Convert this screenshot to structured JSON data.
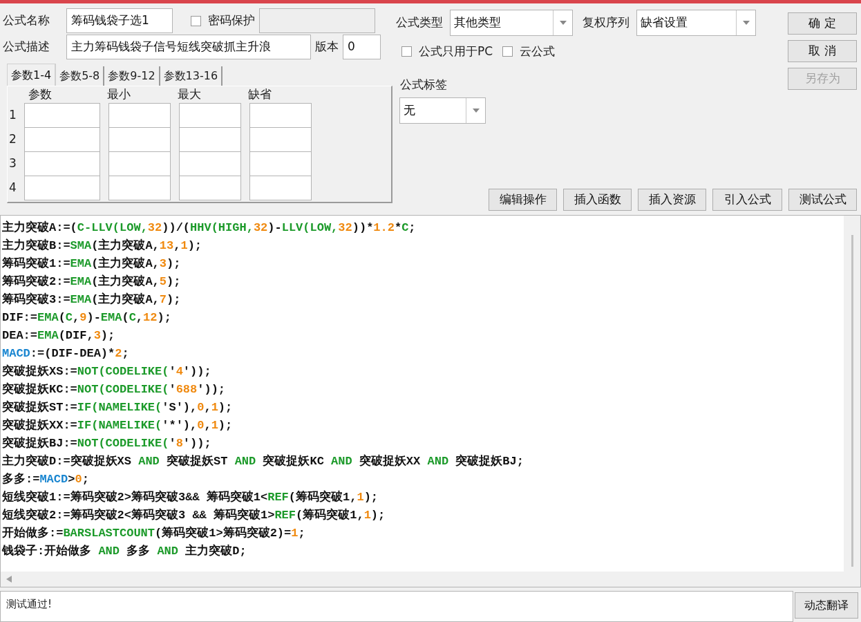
{
  "form": {
    "name": {
      "label": "公式名称",
      "value": "筹码钱袋子选1"
    },
    "password": {
      "label": "密码保护",
      "checked": false
    },
    "password_field": {
      "disabled": true
    },
    "description": {
      "label": "公式描述",
      "value": "主力筹码钱袋子信号短线突破抓主升浪"
    },
    "version": {
      "label": "版本",
      "value": "0"
    }
  },
  "tabs": [
    {
      "label": "参数1-4",
      "selected": true
    },
    {
      "label": "参数5-8",
      "selected": false
    },
    {
      "label": "参数9-12",
      "selected": false
    },
    {
      "label": "参数13-16",
      "selected": false
    }
  ],
  "params": {
    "columns": [
      "参数",
      "最小",
      "最大",
      "缺省"
    ],
    "rows": [
      "1",
      "2",
      "3",
      "4"
    ]
  },
  "formula_type": {
    "label": "公式类型",
    "value": "其他类型"
  },
  "adjust": {
    "label": "复权序列",
    "value": "缺省设置"
  },
  "options": [
    {
      "label": "公式只用于PC",
      "checked": false
    },
    {
      "label": "云公式",
      "checked": false
    }
  ],
  "tag": {
    "label": "公式标签",
    "value": "无"
  },
  "side_buttons": [
    {
      "label": "确 定",
      "disabled": false
    },
    {
      "label": "取 消",
      "disabled": false
    },
    {
      "label": "另存为",
      "disabled": true
    }
  ],
  "tool_buttons": [
    "编辑操作",
    "插入函数",
    "插入资源",
    "引入公式",
    "测试公式"
  ],
  "code": [
    [
      {
        "kind": "text",
        "text": "主力突破A:=("
      },
      {
        "kind": "func",
        "text": "C-LLV(LOW,"
      },
      {
        "kind": "num",
        "text": "32"
      },
      {
        "kind": "text",
        "text": "))/("
      },
      {
        "kind": "func",
        "text": "HHV(HIGH,"
      },
      {
        "kind": "num",
        "text": "32"
      },
      {
        "kind": "text",
        "text": ")-"
      },
      {
        "kind": "func",
        "text": "LLV(LOW,"
      },
      {
        "kind": "num",
        "text": "32"
      },
      {
        "kind": "text",
        "text": "))*"
      },
      {
        "kind": "num",
        "text": "1.2"
      },
      {
        "kind": "text",
        "text": "*"
      },
      {
        "kind": "func",
        "text": "C"
      },
      {
        "kind": "text",
        "text": ";"
      }
    ],
    [
      {
        "kind": "text",
        "text": "主力突破B:="
      },
      {
        "kind": "func",
        "text": "SMA"
      },
      {
        "kind": "text",
        "text": "(主力突破A,"
      },
      {
        "kind": "num",
        "text": "13"
      },
      {
        "kind": "text",
        "text": ","
      },
      {
        "kind": "num",
        "text": "1"
      },
      {
        "kind": "text",
        "text": ");"
      }
    ],
    [
      {
        "kind": "text",
        "text": "筹码突破1:="
      },
      {
        "kind": "func",
        "text": "EMA"
      },
      {
        "kind": "text",
        "text": "(主力突破A,"
      },
      {
        "kind": "num",
        "text": "3"
      },
      {
        "kind": "text",
        "text": ");"
      }
    ],
    [
      {
        "kind": "text",
        "text": "筹码突破2:="
      },
      {
        "kind": "func",
        "text": "EMA"
      },
      {
        "kind": "text",
        "text": "(主力突破A,"
      },
      {
        "kind": "num",
        "text": "5"
      },
      {
        "kind": "text",
        "text": ");"
      }
    ],
    [
      {
        "kind": "text",
        "text": "筹码突破3:="
      },
      {
        "kind": "func",
        "text": "EMA"
      },
      {
        "kind": "text",
        "text": "(主力突破A,"
      },
      {
        "kind": "num",
        "text": "7"
      },
      {
        "kind": "text",
        "text": ");"
      }
    ],
    [
      {
        "kind": "text",
        "text": "DIF:="
      },
      {
        "kind": "func",
        "text": "EMA"
      },
      {
        "kind": "text",
        "text": "("
      },
      {
        "kind": "func",
        "text": "C"
      },
      {
        "kind": "text",
        "text": ","
      },
      {
        "kind": "num",
        "text": "9"
      },
      {
        "kind": "text",
        "text": ")-"
      },
      {
        "kind": "func",
        "text": "EMA"
      },
      {
        "kind": "text",
        "text": "("
      },
      {
        "kind": "func",
        "text": "C"
      },
      {
        "kind": "text",
        "text": ","
      },
      {
        "kind": "num",
        "text": "12"
      },
      {
        "kind": "text",
        "text": ");"
      }
    ],
    [
      {
        "kind": "text",
        "text": "DEA:="
      },
      {
        "kind": "func",
        "text": "EMA"
      },
      {
        "kind": "text",
        "text": "(DIF,"
      },
      {
        "kind": "num",
        "text": "3"
      },
      {
        "kind": "text",
        "text": ");"
      }
    ],
    [
      {
        "kind": "var",
        "text": "MACD"
      },
      {
        "kind": "text",
        "text": ":=(DIF-DEA)*"
      },
      {
        "kind": "num",
        "text": "2"
      },
      {
        "kind": "text",
        "text": ";"
      }
    ],
    [
      {
        "kind": "text",
        "text": "突破捉妖XS:="
      },
      {
        "kind": "func",
        "text": "NOT(CODELIKE("
      },
      {
        "kind": "text",
        "text": "'"
      },
      {
        "kind": "num",
        "text": "4"
      },
      {
        "kind": "text",
        "text": "'));"
      }
    ],
    [
      {
        "kind": "text",
        "text": "突破捉妖KC:="
      },
      {
        "kind": "func",
        "text": "NOT(CODELIKE("
      },
      {
        "kind": "text",
        "text": "'"
      },
      {
        "kind": "num",
        "text": "688"
      },
      {
        "kind": "text",
        "text": "'));"
      }
    ],
    [
      {
        "kind": "text",
        "text": "突破捉妖ST:="
      },
      {
        "kind": "func",
        "text": "IF(NAMELIKE("
      },
      {
        "kind": "text",
        "text": "'S'),"
      },
      {
        "kind": "num",
        "text": "0"
      },
      {
        "kind": "text",
        "text": ","
      },
      {
        "kind": "num",
        "text": "1"
      },
      {
        "kind": "text",
        "text": ");"
      }
    ],
    [
      {
        "kind": "text",
        "text": "突破捉妖XX:="
      },
      {
        "kind": "func",
        "text": "IF(NAMELIKE("
      },
      {
        "kind": "text",
        "text": "'*'),"
      },
      {
        "kind": "num",
        "text": "0"
      },
      {
        "kind": "text",
        "text": ","
      },
      {
        "kind": "num",
        "text": "1"
      },
      {
        "kind": "text",
        "text": ");"
      }
    ],
    [
      {
        "kind": "text",
        "text": "突破捉妖BJ:="
      },
      {
        "kind": "func",
        "text": "NOT(CODELIKE("
      },
      {
        "kind": "text",
        "text": "'"
      },
      {
        "kind": "num",
        "text": "8"
      },
      {
        "kind": "text",
        "text": "'));"
      }
    ],
    [
      {
        "kind": "text",
        "text": "主力突破D:=突破捉妖XS "
      },
      {
        "kind": "func",
        "text": "AND"
      },
      {
        "kind": "text",
        "text": " 突破捉妖ST "
      },
      {
        "kind": "func",
        "text": "AND"
      },
      {
        "kind": "text",
        "text": " 突破捉妖KC "
      },
      {
        "kind": "func",
        "text": "AND"
      },
      {
        "kind": "text",
        "text": " 突破捉妖XX "
      },
      {
        "kind": "func",
        "text": "AND"
      },
      {
        "kind": "text",
        "text": " 突破捉妖BJ;"
      }
    ],
    [
      {
        "kind": "text",
        "text": "多多:="
      },
      {
        "kind": "var",
        "text": "MACD"
      },
      {
        "kind": "text",
        "text": ">"
      },
      {
        "kind": "num",
        "text": "0"
      },
      {
        "kind": "text",
        "text": ";"
      }
    ],
    [
      {
        "kind": "text",
        "text": "短线突破1:=筹码突破2>筹码突破3&& 筹码突破1<"
      },
      {
        "kind": "func",
        "text": "REF"
      },
      {
        "kind": "text",
        "text": "(筹码突破1,"
      },
      {
        "kind": "num",
        "text": "1"
      },
      {
        "kind": "text",
        "text": ");"
      }
    ],
    [
      {
        "kind": "text",
        "text": "短线突破2:=筹码突破2<筹码突破3 && 筹码突破1>"
      },
      {
        "kind": "func",
        "text": "REF"
      },
      {
        "kind": "text",
        "text": "(筹码突破1,"
      },
      {
        "kind": "num",
        "text": "1"
      },
      {
        "kind": "text",
        "text": ");"
      }
    ],
    [
      {
        "kind": "text",
        "text": "开始做多:="
      },
      {
        "kind": "func",
        "text": "BARSLASTCOUNT"
      },
      {
        "kind": "text",
        "text": "(筹码突破1>筹码突破2)="
      },
      {
        "kind": "num",
        "text": "1"
      },
      {
        "kind": "text",
        "text": ";"
      }
    ],
    [
      {
        "kind": "text",
        "text": "钱袋子:开始做多 "
      },
      {
        "kind": "func",
        "text": "AND"
      },
      {
        "kind": "text",
        "text": " 多多 "
      },
      {
        "kind": "func",
        "text": "AND"
      },
      {
        "kind": "text",
        "text": " 主力突破D;"
      }
    ]
  ],
  "status": {
    "message": "测试通过!"
  },
  "translate_button": "动态翻译"
}
